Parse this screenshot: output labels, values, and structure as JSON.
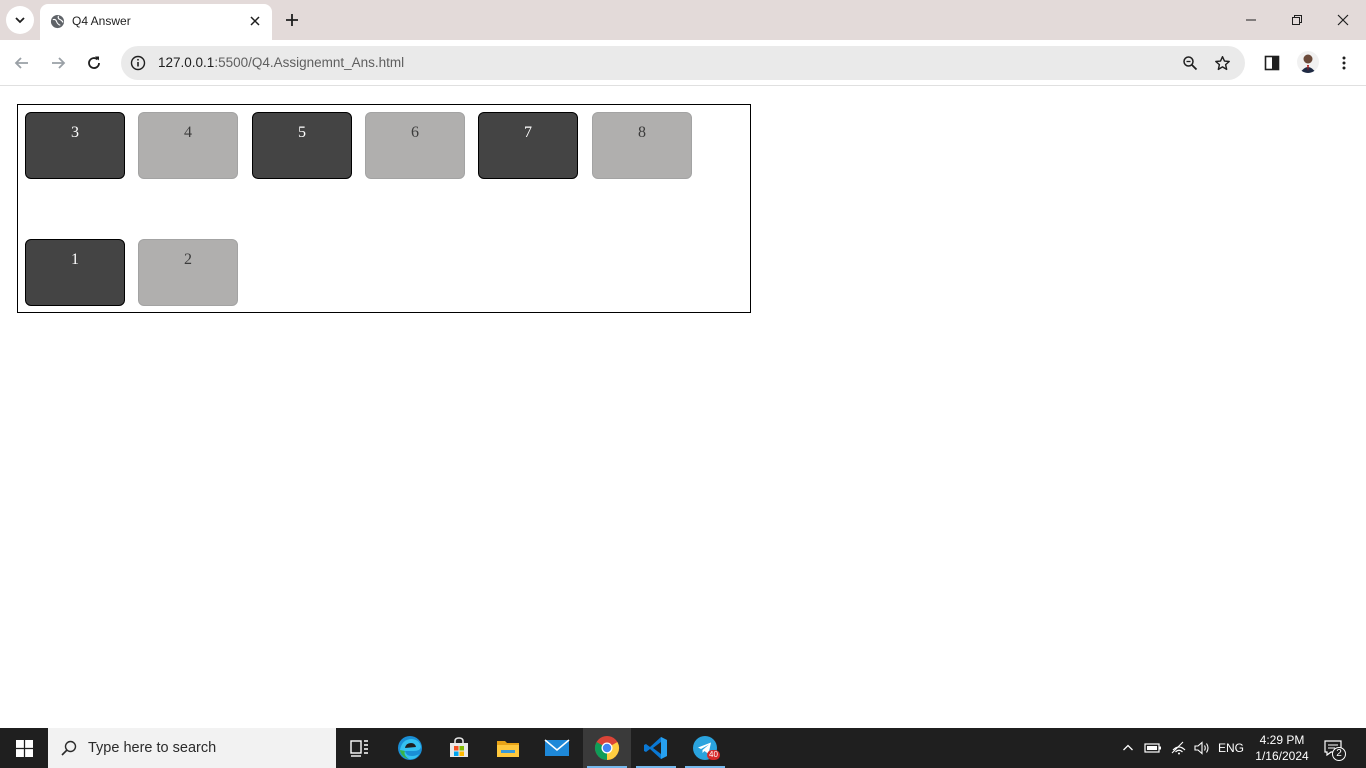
{
  "browser": {
    "tab_title": "Q4 Answer",
    "url_host": "127.0.0.1",
    "url_path": ":5500/Q4.Assignemnt_Ans.html"
  },
  "content": {
    "row1": [
      {
        "label": "3",
        "style": "dark"
      },
      {
        "label": "4",
        "style": "light"
      },
      {
        "label": "5",
        "style": "dark"
      },
      {
        "label": "6",
        "style": "light"
      },
      {
        "label": "7",
        "style": "dark"
      },
      {
        "label": "8",
        "style": "light"
      }
    ],
    "row2": [
      {
        "label": "1",
        "style": "dark"
      },
      {
        "label": "2",
        "style": "light"
      }
    ],
    "colors": {
      "dark": "#444444",
      "light": "#b0afae",
      "border": "#000000"
    }
  },
  "taskbar": {
    "search_placeholder": "Type here to search",
    "apps": [
      "task-view-icon",
      "edge-icon",
      "store-icon",
      "file-explorer-icon",
      "mail-icon",
      "chrome-icon",
      "vscode-icon",
      "telegram-icon"
    ],
    "telegram_badge": "40",
    "language": "ENG",
    "time": "4:29 PM",
    "date": "1/16/2024",
    "notification_count": "2"
  }
}
